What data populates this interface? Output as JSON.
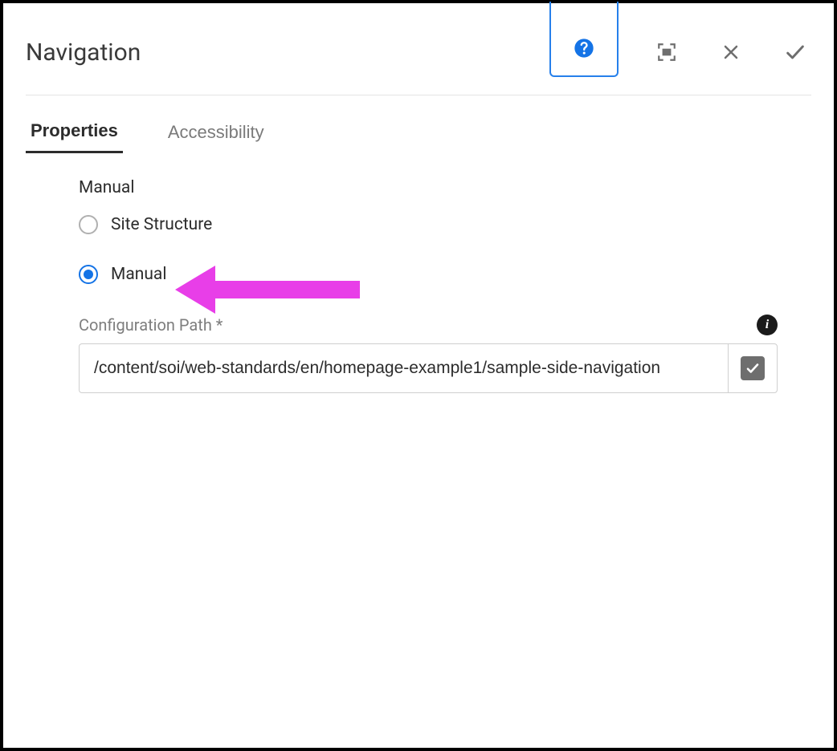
{
  "header": {
    "title": "Navigation",
    "help_icon": "question-circle-icon",
    "fullscreen_icon": "fullscreen-icon",
    "close_icon": "close-icon",
    "done_icon": "check-icon"
  },
  "tabs": {
    "properties": "Properties",
    "accessibility": "Accessibility",
    "active": "properties"
  },
  "form": {
    "section_label": "Manual",
    "radios": {
      "site_structure": {
        "label": "Site Structure",
        "checked": false
      },
      "manual": {
        "label": "Manual",
        "checked": true
      }
    },
    "config_path": {
      "label": "Configuration Path *",
      "value": "/content/soi/web-standards/en/homepage-example1/sample-side-navigation",
      "info_icon": "info-icon",
      "confirm_icon": "check-icon"
    }
  },
  "annotation": {
    "arrow_color": "#e83ee8"
  }
}
